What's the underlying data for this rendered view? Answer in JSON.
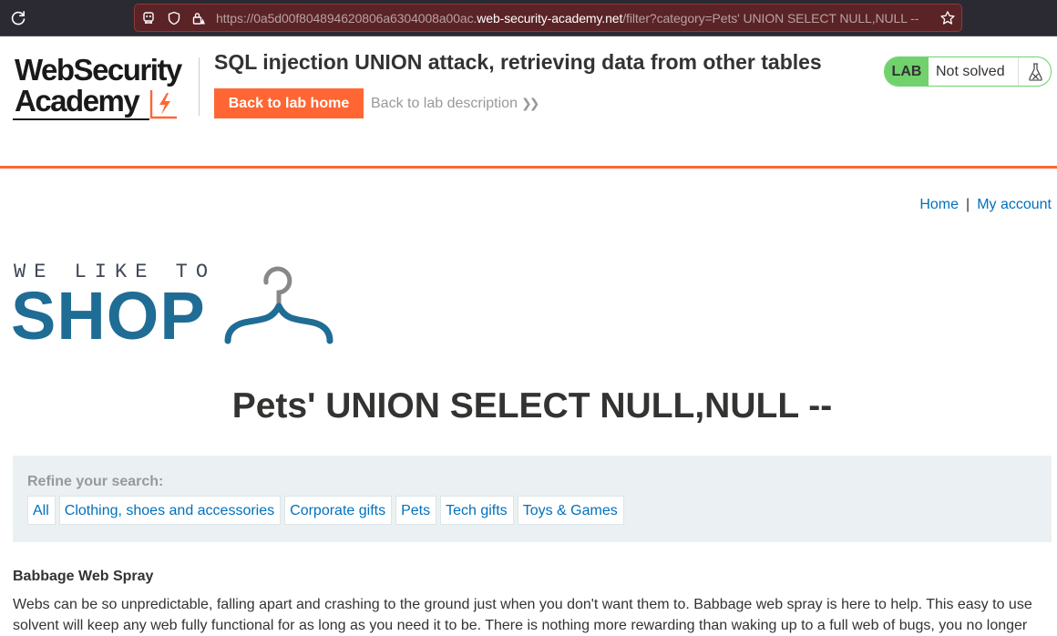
{
  "browser": {
    "url_scheme": "https://0a5d00f804894620806a6304008a00ac.",
    "url_host": "web-security-academy.net",
    "url_path": "/filter?category=Pets' UNION SELECT NULL,NULL --"
  },
  "header": {
    "logo_line1": "WebSecurity",
    "logo_line2": "Academy",
    "lab_title": "SQL injection UNION attack, retrieving data from other tables",
    "back_home_label": "Back to lab home",
    "back_description_label": "Back to lab description",
    "lab_badge": "LAB",
    "lab_status": "Not solved"
  },
  "nav": {
    "home": "Home",
    "separator": "|",
    "my_account": "My account"
  },
  "shop_logo": {
    "tagline": "WE LIKE TO",
    "word": "SHOP"
  },
  "category_heading": "Pets' UNION SELECT NULL,NULL --",
  "filters": {
    "label": "Refine your search:",
    "items": [
      "All",
      "Clothing, shoes and accessories",
      "Corporate gifts",
      "Pets",
      "Tech gifts",
      "Toys & Games"
    ]
  },
  "product": {
    "name": "Babbage Web Spray",
    "description": "Webs can be so unpredictable, falling apart and crashing to the ground just when you don't want them to. Babbage web spray is here to help. This easy to use solvent will keep any web fully functional for as long as you need it to be. There is nothing more rewarding than waking up to a full web of bugs, you no longer"
  },
  "colors": {
    "accent_orange": "#ff6633",
    "lab_green": "#70d16d",
    "link_blue": "#0071bc",
    "shop_blue": "#1f6c95"
  }
}
